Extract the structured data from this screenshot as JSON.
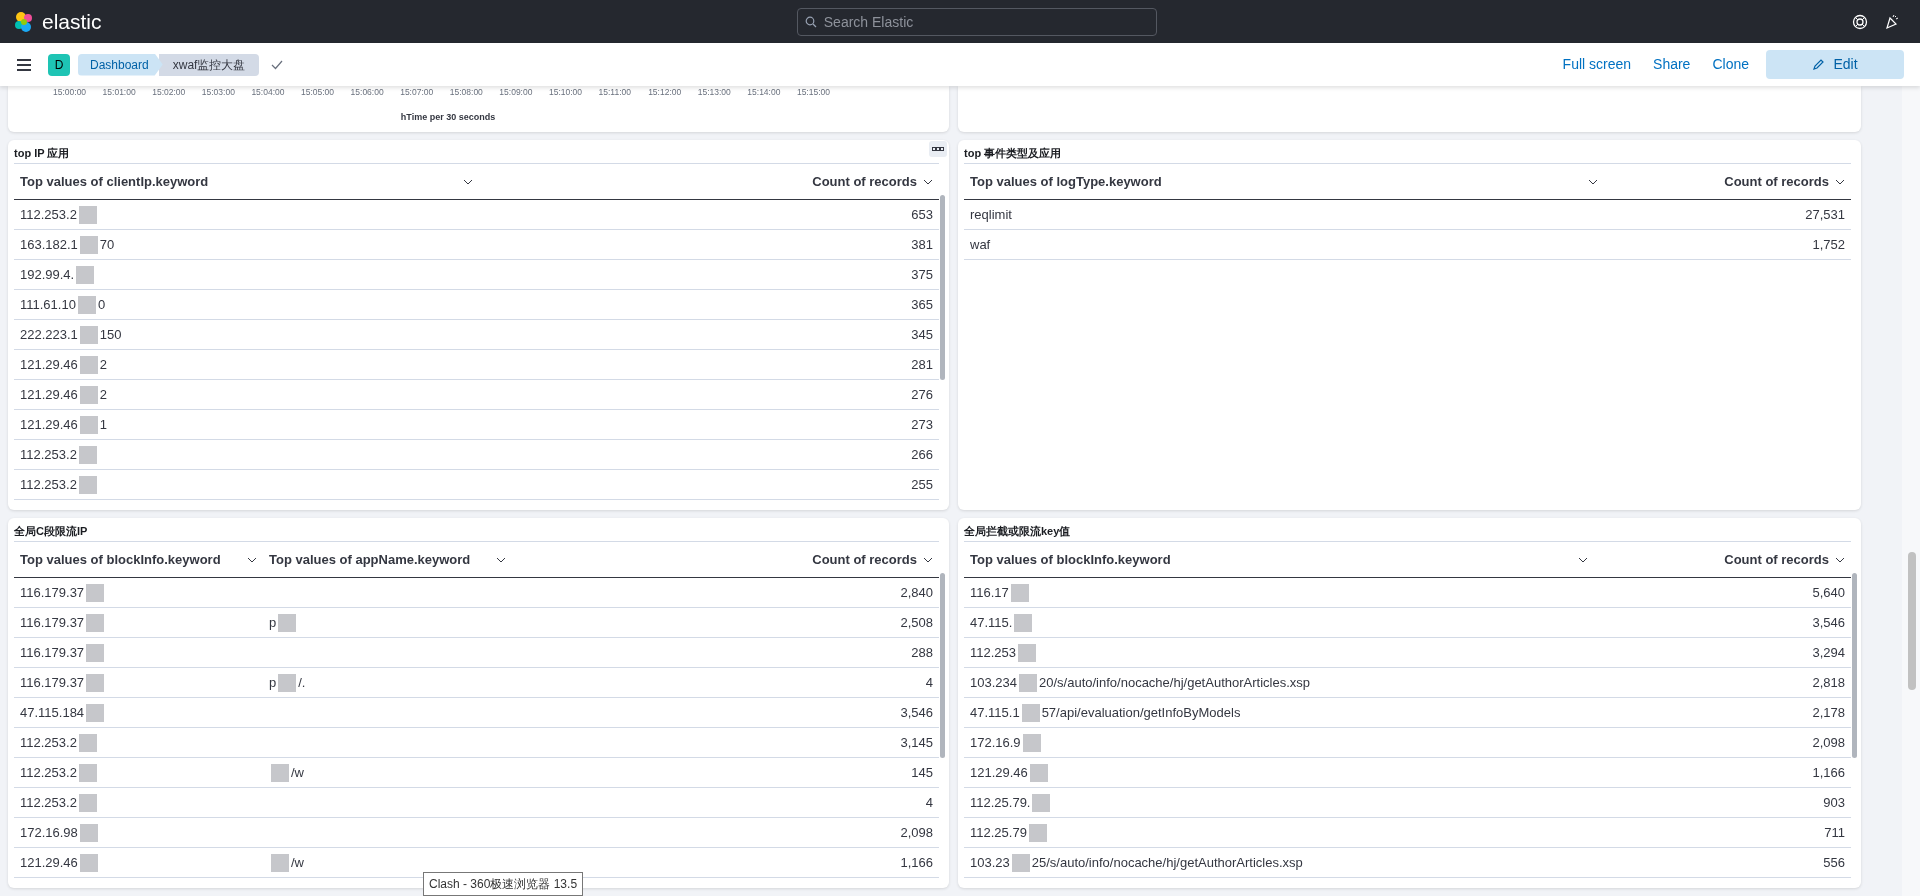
{
  "header": {
    "brand": "elastic",
    "search": {
      "placeholder": "Search Elastic"
    }
  },
  "breadcrumb_bar": {
    "space_initial": "D",
    "breadcrumbs": [
      {
        "label": "Dashboard",
        "selected": false
      },
      {
        "label": "xwaf监控大盘",
        "selected": true
      }
    ],
    "actions": [
      {
        "label": "Full screen",
        "kind": "link"
      },
      {
        "label": "Share",
        "kind": "link"
      },
      {
        "label": "Clone",
        "kind": "link"
      },
      {
        "label": "Edit",
        "kind": "primary"
      }
    ]
  },
  "time_axis": {
    "ticks": [
      "15:00:00",
      "15:01:00",
      "15:02:00",
      "15:03:00",
      "15:04:00",
      "15:05:00",
      "15:06:00",
      "15:07:00",
      "15:08:00",
      "15:09:00",
      "15:10:00",
      "15:11:00",
      "15:12:00",
      "15:13:00",
      "15:14:00",
      "15:15:00"
    ],
    "title": "hTime per 30 seconds"
  },
  "panels": [
    {
      "title": "top IP 应用",
      "menu": true,
      "columns": [
        {
          "label": "Top values of clientIp.keyword"
        },
        {
          "label": "Count of records"
        }
      ],
      "rows": [
        [
          [
            "112.253.2"
          ],
          [
            "653"
          ]
        ],
        [
          [
            "163.182.1",
            "70"
          ],
          [
            "381"
          ]
        ],
        [
          [
            "192.99.4."
          ],
          [
            "375"
          ]
        ],
        [
          [
            "111.61.10",
            "0"
          ],
          [
            "365"
          ]
        ],
        [
          [
            "222.223.1",
            "150"
          ],
          [
            "345"
          ]
        ],
        [
          [
            "121.29.46",
            "2"
          ],
          [
            "281"
          ]
        ],
        [
          [
            "121.29.46",
            "2"
          ],
          [
            "276"
          ]
        ],
        [
          [
            "121.29.46",
            "1"
          ],
          [
            "273"
          ]
        ],
        [
          [
            "112.253.2"
          ],
          [
            "266"
          ]
        ],
        [
          [
            "112.253.2"
          ],
          [
            "255"
          ]
        ]
      ]
    },
    {
      "title": "top 事件类型及应用",
      "menu": false,
      "columns": [
        {
          "label": "Top values of logType.keyword"
        },
        {
          "label": "Count of records"
        }
      ],
      "rows": [
        [
          [
            "reqlimit"
          ],
          [
            "27,531"
          ]
        ],
        [
          [
            "waf"
          ],
          [
            "1,752"
          ]
        ]
      ]
    },
    {
      "title": "全局C段限流IP",
      "menu": false,
      "columns": [
        {
          "label": "Top values of blockInfo.keyword"
        },
        {
          "label": "Top values of appName.keyword"
        },
        {
          "label": "Count of records"
        }
      ],
      "rows": [
        [
          [
            "116.179.37"
          ],
          [],
          [
            "2,840"
          ]
        ],
        [
          [
            "116.179.37"
          ],
          [
            "p"
          ],
          [
            "2,508"
          ]
        ],
        [
          [
            "116.179.37"
          ],
          [],
          [
            "288"
          ]
        ],
        [
          [
            "116.179.37"
          ],
          [
            "p",
            "/."
          ],
          [
            "4"
          ]
        ],
        [
          [
            "47.115.184"
          ],
          [],
          [
            "3,546"
          ]
        ],
        [
          [
            "112.253.2"
          ],
          [],
          [
            "3,145"
          ]
        ],
        [
          [
            "112.253.2"
          ],
          [
            "",
            "/w"
          ],
          [
            "145"
          ]
        ],
        [
          [
            "112.253.2"
          ],
          [],
          [
            "4"
          ]
        ],
        [
          [
            "172.16.98"
          ],
          [],
          [
            "2,098"
          ]
        ],
        [
          [
            "121.29.46"
          ],
          [
            "",
            "/w"
          ],
          [
            "1,166"
          ]
        ]
      ]
    },
    {
      "title": "全局拦截或限流key值",
      "menu": false,
      "columns": [
        {
          "label": "Top values of blockInfo.keyword"
        },
        {
          "label": "Count of records"
        }
      ],
      "rows": [
        [
          [
            "116.17"
          ],
          [
            "5,640"
          ]
        ],
        [
          [
            "47.115."
          ],
          [
            "3,546"
          ]
        ],
        [
          [
            "112.253"
          ],
          [
            "3,294"
          ]
        ],
        [
          [
            "103.234",
            "20/s/auto/info/nocache/hj/getAuthorArticles.xsp"
          ],
          [
            "2,818"
          ]
        ],
        [
          [
            "47.115.1",
            "57/api/evaluation/getInfoByModels"
          ],
          [
            "2,178"
          ]
        ],
        [
          [
            "172.16.9"
          ],
          [
            "2,098"
          ]
        ],
        [
          [
            "121.29.46"
          ],
          [
            "1,166"
          ]
        ],
        [
          [
            "112.25.79."
          ],
          [
            "903"
          ]
        ],
        [
          [
            "112.25.79"
          ],
          [
            "711"
          ]
        ],
        [
          [
            "103.23",
            "25/s/auto/info/nocache/hj/getAuthorArticles.xsp"
          ],
          [
            "556"
          ]
        ]
      ]
    }
  ],
  "tooltip": "Clash - 360极速浏览器 13.5"
}
